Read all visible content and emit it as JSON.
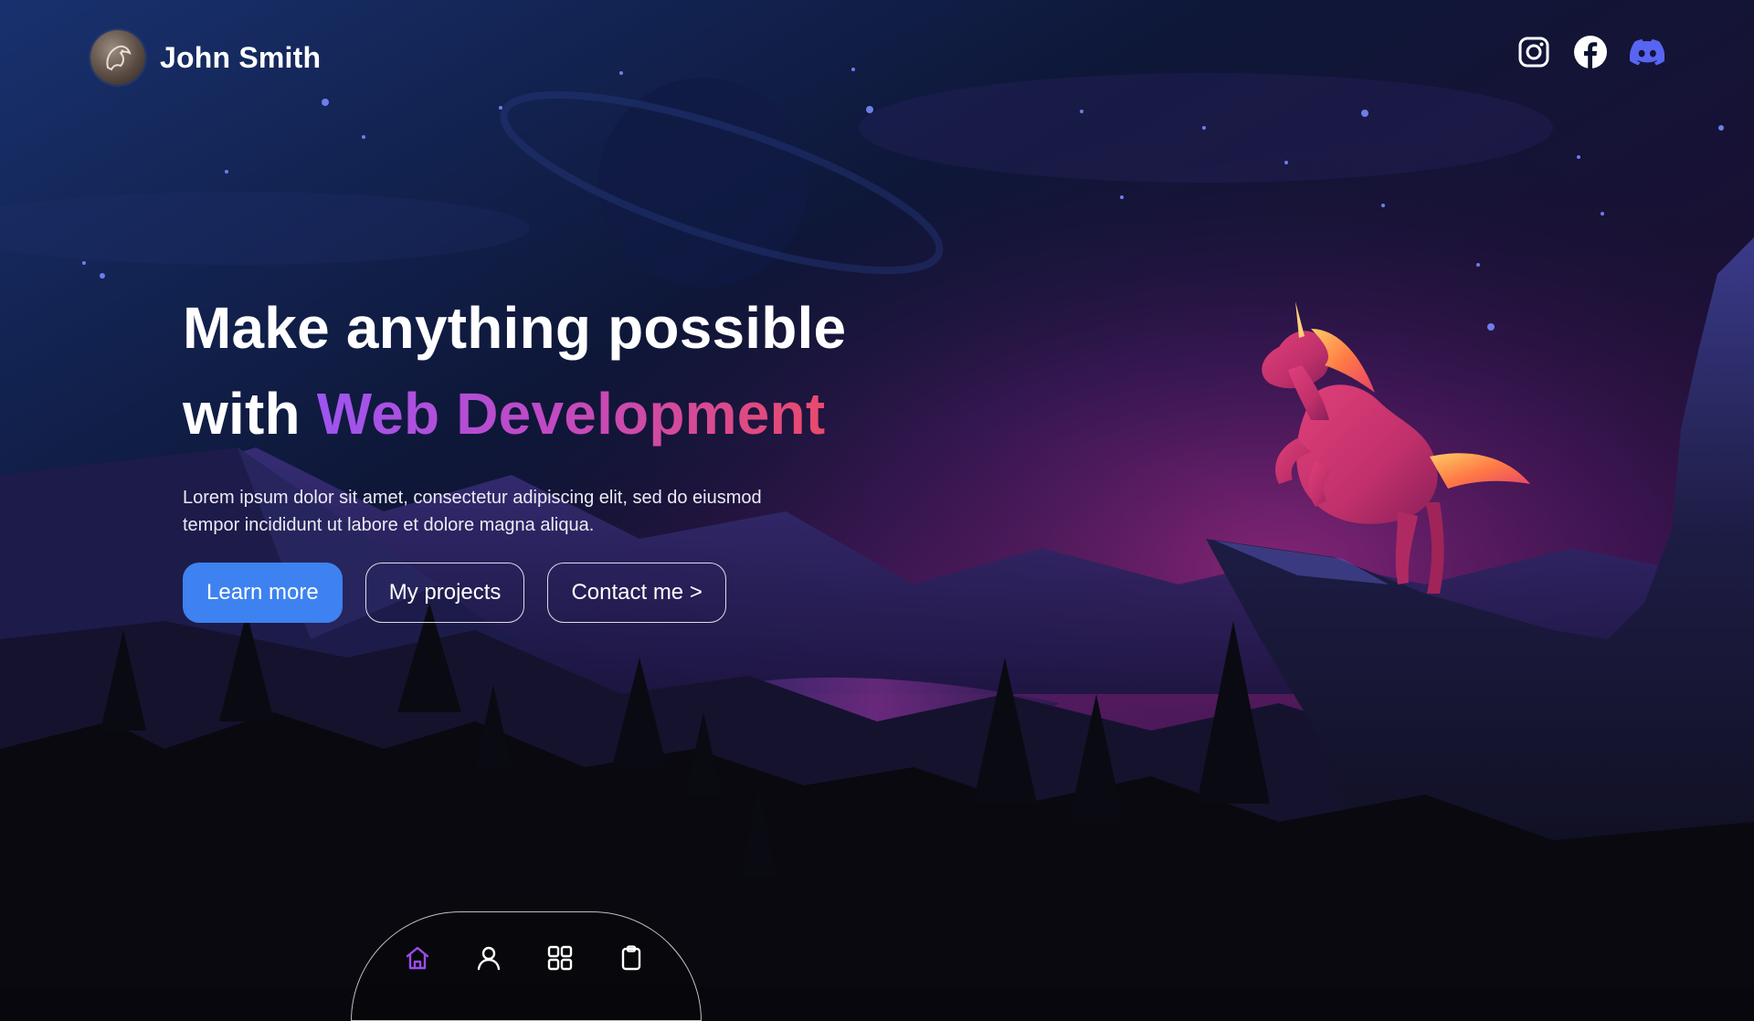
{
  "header": {
    "name": "John Smith",
    "avatar_icon": "horse-avatar-icon",
    "socials": [
      {
        "name": "instagram-icon",
        "color": "#ffffff"
      },
      {
        "name": "facebook-icon",
        "color": "#ffffff"
      },
      {
        "name": "discord-icon",
        "color": "#5865f2"
      }
    ]
  },
  "hero": {
    "title_line1": "Make anything possible",
    "title_prefix": "with ",
    "title_highlight": "Web Development",
    "description_line1": "Lorem ipsum dolor sit amet, consectetur adipiscing elit, sed do eiusmod",
    "description_line2": "tempor incididunt ut labore et dolore magna aliqua.",
    "buttons": {
      "learn_more": "Learn more",
      "my_projects": "My projects",
      "contact": "Contact me >"
    }
  },
  "nav": {
    "items": [
      {
        "icon": "home-icon",
        "active": true
      },
      {
        "icon": "user-icon",
        "active": false
      },
      {
        "icon": "grid-icon",
        "active": false
      },
      {
        "icon": "clipboard-icon",
        "active": false
      }
    ],
    "active_color": "#9b4de8"
  },
  "colors": {
    "accent": "#3d82f0",
    "gradient_start": "#9d55f0",
    "gradient_end": "#ea4a6c",
    "sky_top": "#13245a",
    "sky_glow": "#5a1a5e"
  }
}
